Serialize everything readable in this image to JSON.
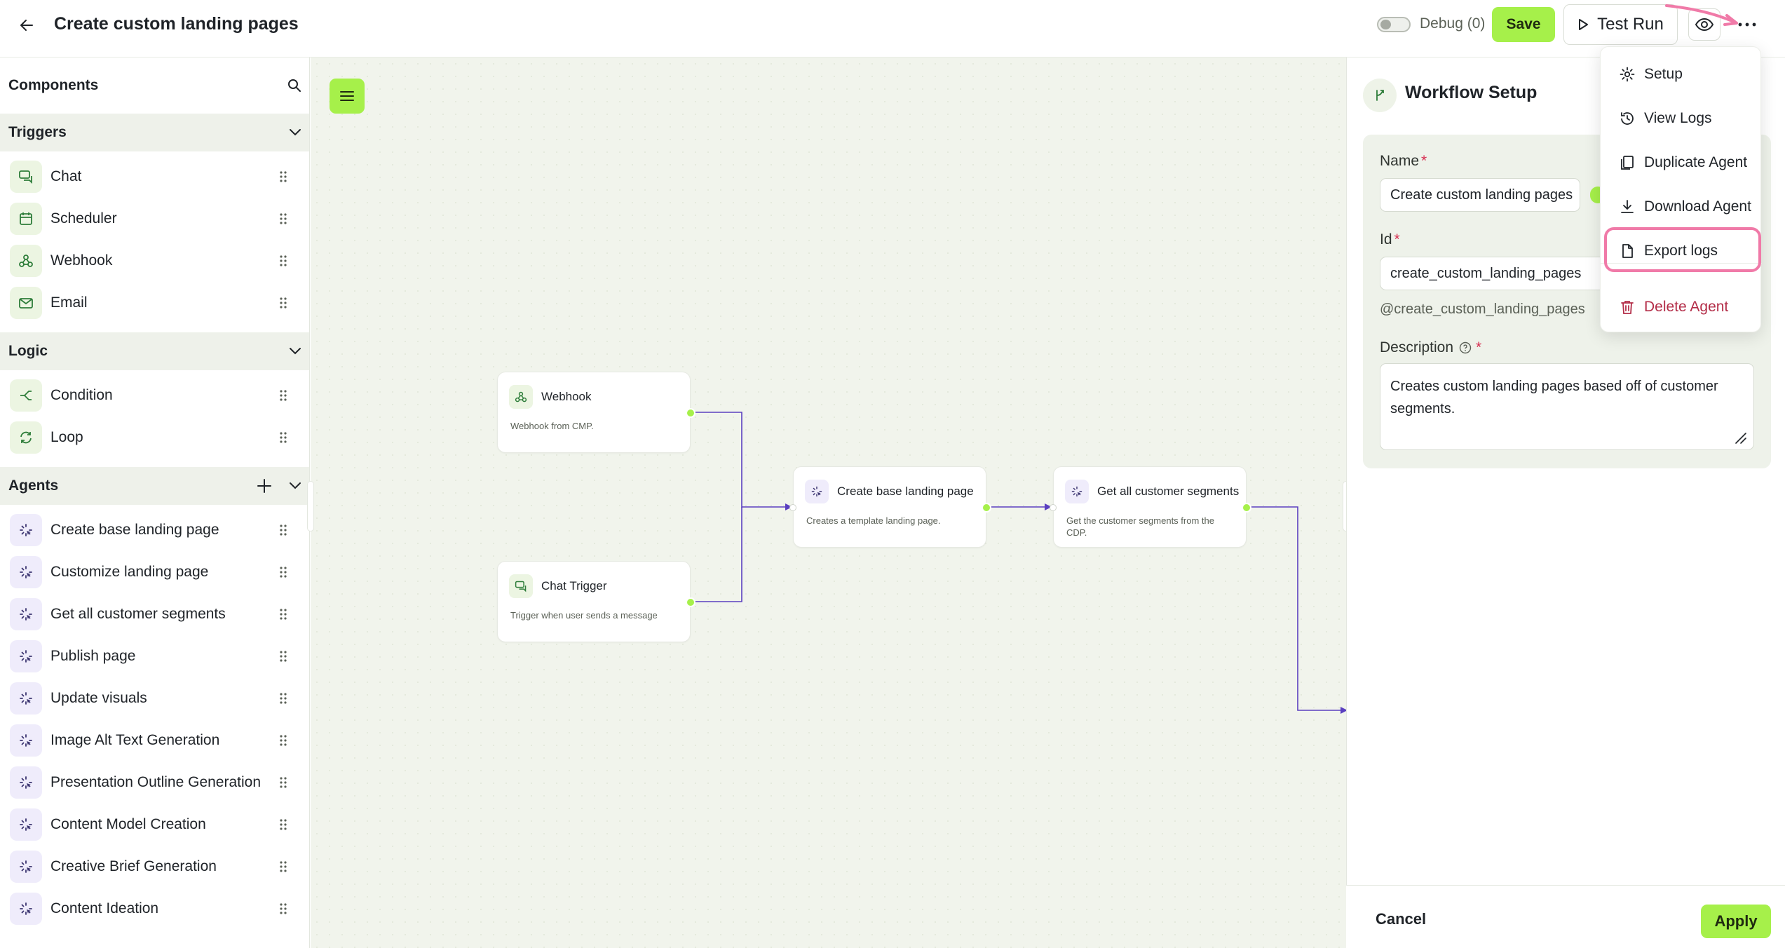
{
  "header": {
    "title": "Create custom landing pages",
    "debug_label": "Debug (0)",
    "save_label": "Save",
    "test_run_label": "Test Run"
  },
  "sidebar": {
    "title": "Components",
    "sections": [
      {
        "title": "Triggers",
        "items": [
          {
            "label": "Chat",
            "icon": "chat-icon"
          },
          {
            "label": "Scheduler",
            "icon": "calendar-icon"
          },
          {
            "label": "Webhook",
            "icon": "webhook-icon"
          },
          {
            "label": "Email",
            "icon": "mail-icon"
          }
        ]
      },
      {
        "title": "Logic",
        "items": [
          {
            "label": "Condition",
            "icon": "branch-icon"
          },
          {
            "label": "Loop",
            "icon": "loop-icon"
          }
        ]
      },
      {
        "title": "Agents",
        "items": [
          {
            "label": "Create base landing page",
            "icon": "agent-icon"
          },
          {
            "label": "Customize landing page",
            "icon": "agent-icon"
          },
          {
            "label": "Get all customer segments",
            "icon": "agent-icon"
          },
          {
            "label": "Publish page",
            "icon": "agent-icon"
          },
          {
            "label": "Update visuals",
            "icon": "agent-icon"
          },
          {
            "label": "Image Alt Text Generation",
            "icon": "agent-icon"
          },
          {
            "label": "Presentation Outline Generation",
            "icon": "agent-icon"
          },
          {
            "label": "Content Model Creation",
            "icon": "agent-icon"
          },
          {
            "label": "Creative Brief Generation",
            "icon": "agent-icon"
          },
          {
            "label": "Content Ideation",
            "icon": "agent-icon"
          }
        ]
      }
    ]
  },
  "canvas": {
    "nodes": [
      {
        "title": "Webhook",
        "desc": "Webhook from CMP."
      },
      {
        "title": "Chat Trigger",
        "desc": "Trigger when user sends a message"
      },
      {
        "title": "Create base landing page",
        "desc": "Creates a template landing page."
      },
      {
        "title": "Get all customer segments",
        "desc": "Get the customer segments from the CDP."
      }
    ]
  },
  "workflow_setup": {
    "title": "Workflow Setup",
    "name_label": "Name",
    "name_value": "Create custom landing pages",
    "id_label": "Id",
    "id_value": "create_custom_landing_pages",
    "handle": "@create_custom_landing_pages",
    "description_label": "Description",
    "description_value": "Creates custom landing pages based off of customer segments.",
    "cancel_label": "Cancel",
    "apply_label": "Apply"
  },
  "menu": {
    "items": [
      {
        "label": "Setup",
        "icon": "gear-icon"
      },
      {
        "label": "View Logs",
        "icon": "history-icon"
      },
      {
        "label": "Duplicate Agent",
        "icon": "copy-icon"
      },
      {
        "label": "Download Agent",
        "icon": "download-icon"
      },
      {
        "label": "Export logs",
        "icon": "file-icon"
      },
      {
        "label": "Delete Agent",
        "icon": "trash-icon"
      }
    ]
  },
  "colors": {
    "accent": "#a6f04a",
    "canvas_bg": "#f1f4ec",
    "edge": "#5a3fc0",
    "danger": "#b32d48",
    "highlight": "#f07aa8"
  }
}
